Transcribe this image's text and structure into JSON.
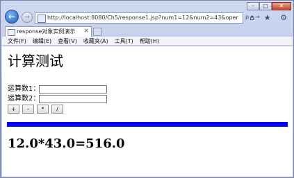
{
  "browser": {
    "url": "http://localhost:8080/Ch5/response1.jsp?num1=12&num2=43&oper",
    "url_tools": "ρ ▾ →",
    "tab_title": "response对象实例演示",
    "tab_close": "×",
    "window_buttons": {
      "minimize": "–",
      "maximize": "□",
      "close": "✕"
    },
    "side_icons": "⌂ ★ ⚙",
    "menu": [
      "文件(F)",
      "编辑(E)",
      "查看(V)",
      "收藏夹(A)",
      "工具(T)",
      "帮助(H)"
    ]
  },
  "page": {
    "title": "计算测试",
    "operand1_label": "运算数1：",
    "operand1_value": "",
    "operand2_label": "运算数2：",
    "operand2_value": "",
    "operators": [
      "+",
      "-",
      "*",
      "/"
    ],
    "result": "12.0*43.0=516.0",
    "bar_color": "#0000ff"
  }
}
